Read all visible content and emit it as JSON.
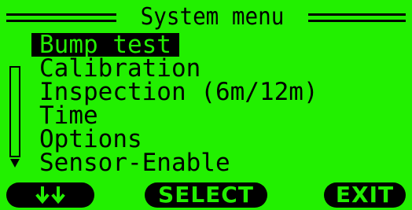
{
  "header": {
    "title": "System menu"
  },
  "menu": {
    "items": [
      {
        "label": "Bump test",
        "selected": true
      },
      {
        "label": "Calibration",
        "selected": false
      },
      {
        "label": "Inspection (6m/12m)",
        "selected": false
      },
      {
        "label": "Time",
        "selected": false
      },
      {
        "label": "Options",
        "selected": false
      },
      {
        "label": "Sensor-Enable",
        "selected": false
      }
    ]
  },
  "softkeys": {
    "left_icon": "double-down-arrow-icon",
    "center_label": "SELECT",
    "right_label": "EXIT"
  },
  "colors": {
    "screen_background": "#22f000",
    "foreground": "#000000"
  }
}
